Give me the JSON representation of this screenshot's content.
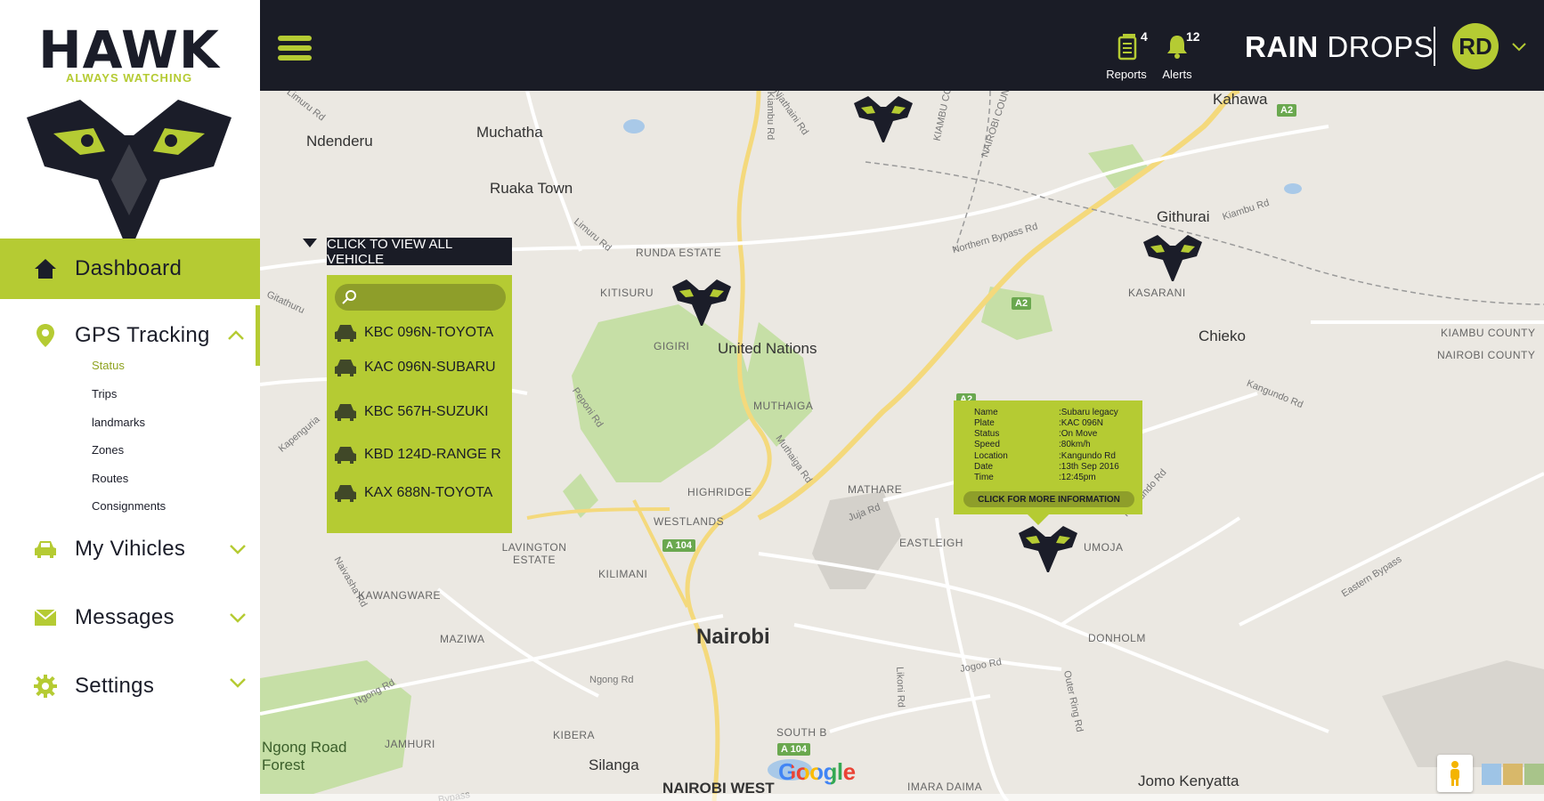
{
  "brand_logo": {
    "name": "HAWK",
    "tagline": "ALWAYS WATCHING"
  },
  "sidebar": {
    "dashboard": "Dashboard",
    "gps_tracking": "GPS Tracking",
    "gps_sub": [
      "Status",
      "Trips",
      "landmarks",
      "Zones",
      "Routes",
      "Consignments"
    ],
    "my_vehicles": "My Vihicles",
    "messages": "Messages",
    "settings": "Settings"
  },
  "topbar": {
    "reports_label": "Reports",
    "reports_count": "4",
    "alerts_label": "Alerts",
    "alerts_count": "12",
    "company_bold": "RAIN",
    "company_light": "DROPS",
    "avatar_initials": "RD"
  },
  "vehicles_panel": {
    "toggle_label": "CLICK TO VIEW ALL VEHICLE",
    "search_placeholder": "",
    "items": [
      "KBC 096N-TOYOTA",
      "KAC 096N-SUBARU",
      "KBC 567H-SUZUKI",
      "KBD 124D-RANGE R",
      "KAX 688N-TOYOTA"
    ]
  },
  "info_popup": {
    "keys": [
      "Name",
      "Plate",
      "Status",
      "Speed",
      "Location",
      "Date",
      "Time"
    ],
    "values": [
      ":Subaru legacy",
      ":KAC 096N",
      ":On Move",
      ":80km/h",
      ":Kangundo Rd",
      ":13th Sep 2016",
      ":12:45pm"
    ],
    "button": "CLICK FOR MORE INFORMATION"
  },
  "map": {
    "places": {
      "nairobi": "Nairobi",
      "united_nations": "United Nations",
      "githurai": "Githurai",
      "chieko": "Chieko",
      "kahawa": "Kahawa",
      "ndenderu": "Ndenderu",
      "muchatha": "Muchatha",
      "ruaka": "Ruaka Town",
      "silanga": "Silanga",
      "jomo": "Jomo Kenyatta",
      "nairobi_west": "NAIROBI WEST",
      "ngong_forest": "Ngong Road Forest"
    },
    "areas": {
      "runda": "RUNDA ESTATE",
      "kitisuru": "KITISURU",
      "gigiri": "GIGIRI",
      "muthaiga": "MUTHAIGA",
      "highridge": "HIGHRIDGE",
      "westlands": "WESTLANDS",
      "lavington": "LAVINGTON ESTATE",
      "kawangware": "KAWANGWARE",
      "kilimani": "KILIMANI",
      "maziwa": "MAZIWA",
      "mathare": "MATHARE",
      "eastleigh": "EASTLEIGH",
      "umoja": "UMOJA",
      "donholm": "DONHOLM",
      "kasarani": "KASARANI",
      "kibera": "KIBERA",
      "jamhuri": "JAMHURI",
      "south_b": "SOUTH B",
      "imara": "IMARA DAIMA",
      "kiambu_county": "KIAMBU COUNTY",
      "nairobi_county": "NAIROBI COUNTY"
    },
    "roads": {
      "limuru1": "Limuru Rd",
      "limuru2": "Limuru Rd",
      "northern": "Northern Bypass Rd",
      "kiambu": "Kiambu Rd",
      "peponi": "Peponi Rd",
      "muthaiga": "Muthaiga Rd",
      "juja": "Juja Rd",
      "kangundo1": "Kangundo Rd",
      "kangundo2": "Kangundo Rd",
      "eastern": "Eastern Bypass",
      "jogoo": "Jogoo Rd",
      "ngong1": "Ngong Rd",
      "ngong2": "Ngong Rd",
      "naivasha": "Naivasha Rd",
      "outer_ring": "Outer Ring Rd",
      "likoni": "Likoni Rd",
      "gitathuru": "Gitathuru",
      "kapengurie": "Kapenguria",
      "njathaini": "Njathaini Rd",
      "kiambu_county_rd": "KIAMBU CO",
      "nairobi_county_rd": "NAIROBI COUN",
      "kiambu_rd2": "Kiambu Rd",
      "bypass": "Bypass"
    },
    "shields": [
      "A2",
      "A2",
      "A 104",
      "A 104",
      "A2"
    ],
    "google": "Google"
  },
  "colors": {
    "accent": "#b5cb33",
    "dark": "#1a1c26"
  }
}
